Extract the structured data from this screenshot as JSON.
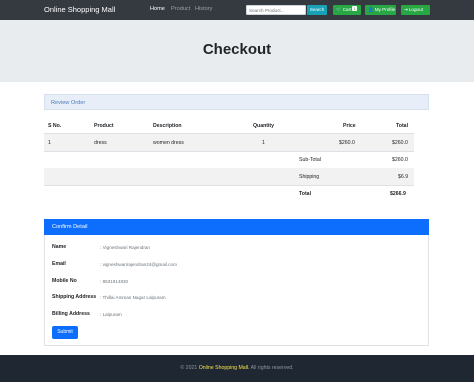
{
  "navbar": {
    "brand": "Online Shopping Mall",
    "links": [
      {
        "label": "Home",
        "active": true
      },
      {
        "label": "Product",
        "active": false
      },
      {
        "label": "History",
        "active": false
      }
    ],
    "search": {
      "placeholder": "Search Product...",
      "button": "Search"
    },
    "cart": {
      "label": "Cart",
      "count": "1"
    },
    "profile_label": "My Profile",
    "logout_label": "Logout"
  },
  "page_title": "Checkout",
  "review": {
    "heading": "Review Order",
    "columns": [
      "S No.",
      "Product",
      "Description",
      "Quantity",
      "Price",
      "Total"
    ],
    "rows": [
      {
        "sno": "1",
        "product": "dress",
        "description": "women dress",
        "quantity": "1",
        "price": "$260.0",
        "total": "$260.0"
      }
    ],
    "summary": {
      "subtotal_label": "Sub-Total",
      "subtotal": "$260.0",
      "shipping_label": "Shipping",
      "shipping": "$6.9",
      "total_label": "Total",
      "total": "$266.9"
    }
  },
  "confirm": {
    "heading": "Confirm Detail",
    "fields": [
      {
        "label": "Name",
        "value": "Vigneshwari Rajendran"
      },
      {
        "label": "Email",
        "value": "vigneshwarirajendran24@gmail.com"
      },
      {
        "label": "Mobile No",
        "value": "8531914830"
      },
      {
        "label": "Shipping Address",
        "value": "Thillai Amman Nagar Lalpuram"
      },
      {
        "label": "Billing Address",
        "value": "Lalpuram"
      }
    ],
    "separator": ":",
    "submit_label": "Submit"
  },
  "footer": {
    "prefix": "© 2021",
    "brand": "Online Shopping Mall.",
    "suffix": "All rights reserved."
  },
  "colors": {
    "navbar": "#343a40",
    "accent": "#0d6efd",
    "search_button": "#17a2b8",
    "nav_buttons": "#28a745",
    "footer": "#1f2733",
    "footer_brand": "#f5e14a"
  }
}
